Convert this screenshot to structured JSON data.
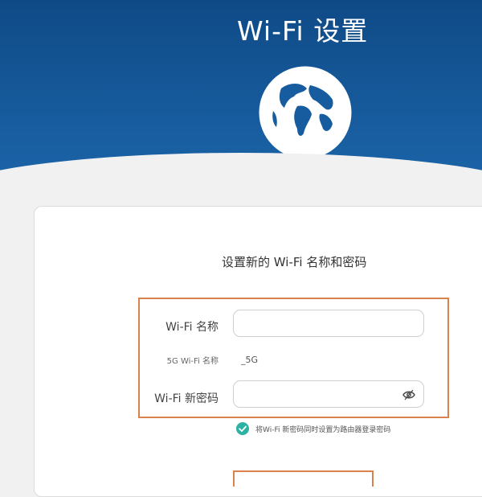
{
  "header": {
    "title": "Wi-Fi 设置",
    "globe_icon": "globe-icon"
  },
  "form": {
    "subtitle": "设置新的 Wi-Fi 名称和密码",
    "wifi_name_label": "Wi-Fi 名称",
    "wifi_name_value": "",
    "wifi_5g_label": "5G Wi-Fi 名称",
    "wifi_5g_value": "_5G",
    "wifi_password_label": "Wi-Fi 新密码",
    "wifi_password_value": "",
    "password_visibility_icon": "eye-icon",
    "sync_checkbox_checked": true,
    "sync_checkbox_label": "将Wi-Fi 新密码同时设置为路由器登录密码"
  },
  "colors": {
    "header_blue": "#175c9e",
    "highlight_orange": "#d9824b",
    "checkbox_teal": "#2bb2a2"
  }
}
